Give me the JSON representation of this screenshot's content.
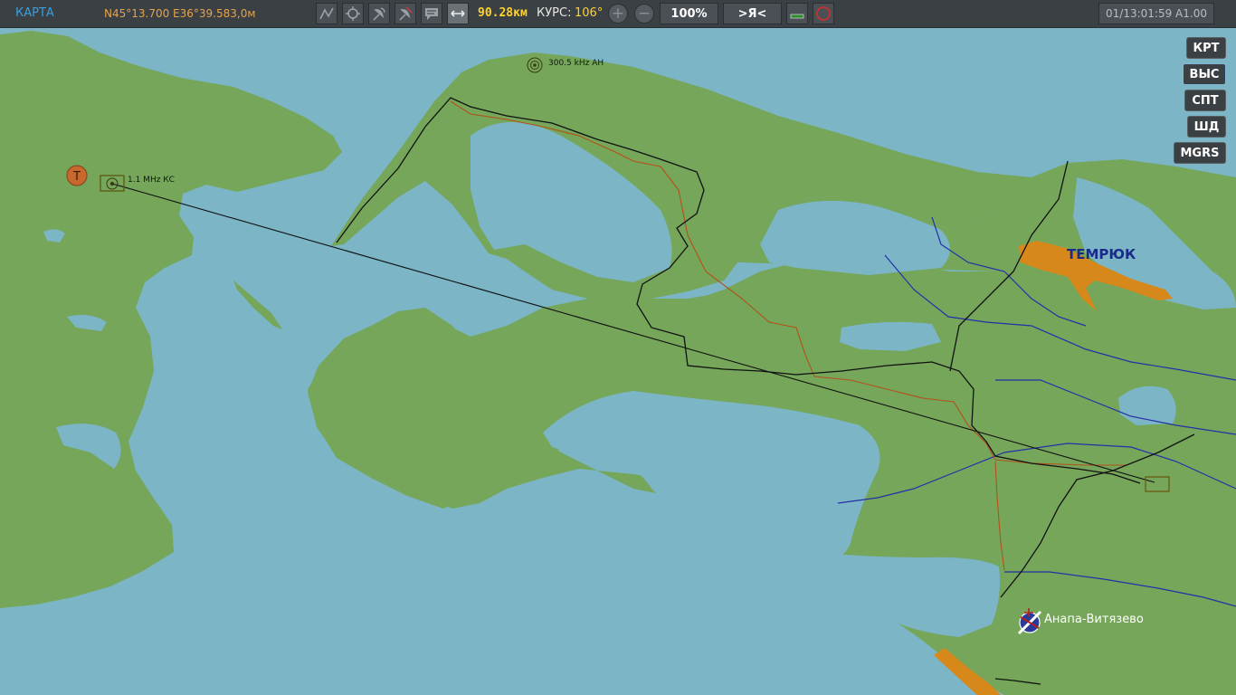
{
  "toolbar": {
    "title": "КАРТА",
    "coordinates": "N45°13.700 E36°39.583,0м",
    "distance": "90.28км",
    "course_label": "КУРС:",
    "course_value": "106°",
    "zoom_in": "+",
    "zoom_out": "−",
    "scale": "100%",
    "center_on_self": ">Я<",
    "time": "01/13:01:59 A1.00",
    "icons": [
      "route-icon",
      "navaid-icon",
      "radar-icon",
      "sam-threat-icon",
      "message-icon",
      "measure-icon",
      "status-bar-icon",
      "stop-icon"
    ]
  },
  "side_buttons": [
    "КРТ",
    "ВЫС",
    "СПТ",
    "ШД",
    "MGRS"
  ],
  "side_active": "ВЫС",
  "map": {
    "labels": {
      "city_temryuk": "ТЕМРЮК",
      "airfield_anapa": "Анапа-Витязево",
      "beacon_1": "1.1 MHz КС",
      "beacon_2": "300.5 kHz АН",
      "tanker_marker": "T"
    },
    "colors": {
      "water": "#7bb5c6",
      "land": "#75a65a",
      "urban": "#d6891a",
      "rail": "#111111",
      "road": "#b4501a",
      "river": "#2430a8"
    }
  }
}
